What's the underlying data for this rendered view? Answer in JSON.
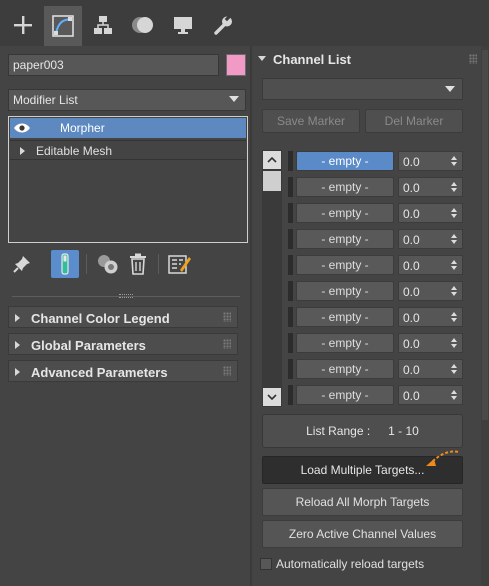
{
  "command_tabs": [
    {
      "name": "create-tab",
      "icon": "plus-icon"
    },
    {
      "name": "modify-tab",
      "icon": "modify-curve-icon",
      "active": true
    },
    {
      "name": "hierarchy-tab",
      "icon": "hierarchy-icon"
    },
    {
      "name": "motion-tab",
      "icon": "motion-icon"
    },
    {
      "name": "display-tab",
      "icon": "monitor-icon"
    },
    {
      "name": "utilities-tab",
      "icon": "wrench-icon"
    }
  ],
  "object": {
    "name": "paper003",
    "color": "#f29ac6"
  },
  "modifier_list": {
    "label": "Modifier List"
  },
  "modifier_stack": [
    {
      "label": "Morpher",
      "selected": true,
      "visibility_icon": "eye-icon"
    },
    {
      "label": "Editable Mesh",
      "selected": false
    }
  ],
  "stack_tools": [
    "pin-stack-icon",
    "show-end-result-icon",
    "make-unique-icon",
    "remove-modifier-icon",
    "configure-modifier-sets-icon"
  ],
  "rollouts_left": [
    {
      "label": "Channel Color Legend"
    },
    {
      "label": "Global Parameters"
    },
    {
      "label": "Advanced Parameters"
    }
  ],
  "channel_list_panel": {
    "title": "Channel List",
    "marker_dropdown_value": "",
    "save_marker_label": "Save Marker",
    "del_marker_label": "Del Marker",
    "channels": [
      {
        "name": "- empty -",
        "value": "0.0",
        "active": true
      },
      {
        "name": "- empty -",
        "value": "0.0"
      },
      {
        "name": "- empty -",
        "value": "0.0"
      },
      {
        "name": "- empty -",
        "value": "0.0"
      },
      {
        "name": "- empty -",
        "value": "0.0"
      },
      {
        "name": "- empty -",
        "value": "0.0"
      },
      {
        "name": "- empty -",
        "value": "0.0"
      },
      {
        "name": "- empty -",
        "value": "0.0"
      },
      {
        "name": "- empty -",
        "value": "0.0"
      },
      {
        "name": "- empty -",
        "value": "0.0"
      }
    ],
    "list_range_label": "List Range :",
    "list_range_value": "1 - 10",
    "load_multiple_label": "Load Multiple Targets...",
    "reload_all_label": "Reload All Morph Targets",
    "zero_active_label": "Zero Active Channel Values",
    "auto_reload_label": "Automatically reload targets",
    "auto_reload_checked": false,
    "annotation_color": "#f08a1c"
  }
}
